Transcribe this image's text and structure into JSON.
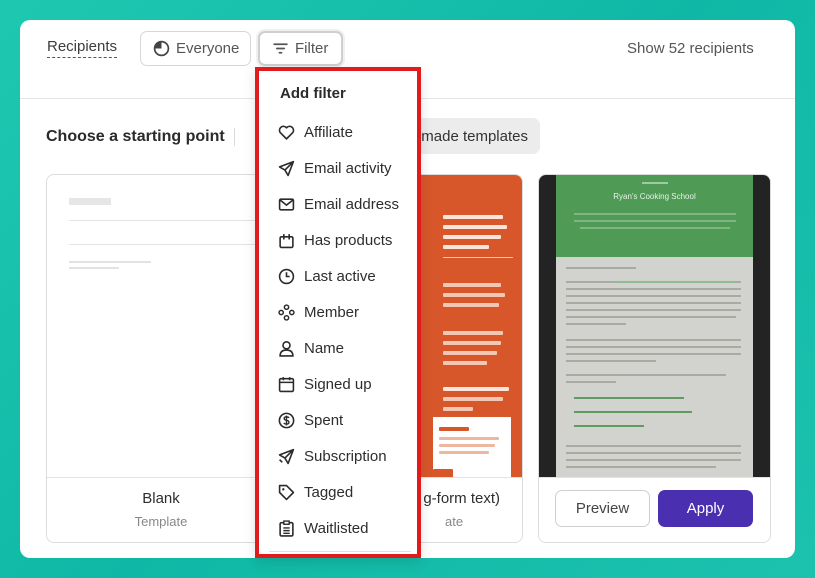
{
  "topbar": {
    "recipients_label": "Recipients",
    "everyone_label": "Everyone",
    "filter_label": "Filter",
    "show_recipients_label": "Show 52 recipients"
  },
  "starting_point": {
    "title": "Choose a starting point",
    "premade_tab_label": "made templates"
  },
  "templates": [
    {
      "name": "Blank",
      "subtitle": "Template"
    },
    {
      "name": "g-form text)",
      "subtitle": "ate"
    },
    {
      "name": "Ryan's Cooking School",
      "preview_button": "Preview",
      "apply_button": "Apply"
    }
  ],
  "dropdown": {
    "title": "Add filter",
    "items": [
      {
        "label": "Affiliate",
        "icon": "heart-icon"
      },
      {
        "label": "Email activity",
        "icon": "paper-plane-icon"
      },
      {
        "label": "Email address",
        "icon": "envelope-icon"
      },
      {
        "label": "Has products",
        "icon": "shopping-bag-icon"
      },
      {
        "label": "Last active",
        "icon": "clock-icon"
      },
      {
        "label": "Member",
        "icon": "member-nodes-icon"
      },
      {
        "label": "Name",
        "icon": "person-icon"
      },
      {
        "label": "Signed up",
        "icon": "calendar-icon"
      },
      {
        "label": "Spent",
        "icon": "dollar-circle-icon"
      },
      {
        "label": "Subscription",
        "icon": "send-repeat-icon"
      },
      {
        "label": "Tagged",
        "icon": "tag-icon"
      },
      {
        "label": "Waitlisted",
        "icon": "clipboard-list-icon"
      }
    ]
  },
  "colors": {
    "background": "#1ec8b0",
    "dropdown_highlight": "#e11b1b",
    "apply_button": "#4a2fb0",
    "orange_template": "#d7572a",
    "recipe_header": "#4f9a55"
  }
}
